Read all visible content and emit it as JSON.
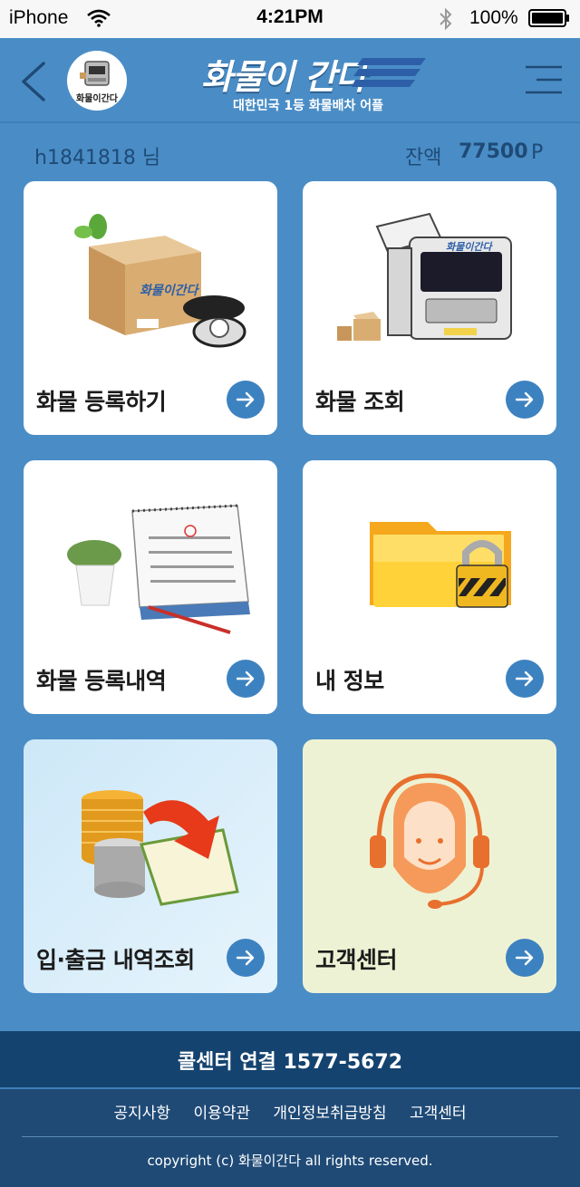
{
  "status_bar": {
    "carrier": "iPhone",
    "time": "4:21PM",
    "battery": "100%"
  },
  "header": {
    "logo_title": "화물이 간다",
    "logo_subtitle": "대한민국 1등 화물배차 어플",
    "avatar_text": "화물이간다"
  },
  "user": {
    "id": "h1841818 님",
    "balance_label": "잔액",
    "balance_value": "77500",
    "balance_unit": "P"
  },
  "menu": [
    {
      "label": "화물 등록하기",
      "icon": "cargo-box-phone-icon"
    },
    {
      "label": "화물 조회",
      "icon": "truck-icon"
    },
    {
      "label": "화물 등록내역",
      "icon": "calendar-icon"
    },
    {
      "label": "내 정보",
      "icon": "locked-folder-icon"
    },
    {
      "label": "입·출금 내역조회",
      "icon": "coins-icon"
    },
    {
      "label": "고객센터",
      "icon": "support-agent-icon"
    }
  ],
  "illustration_text": {
    "box_brand": "화물이간다",
    "truck_brand": "화물이간다"
  },
  "footer": {
    "call": "콜센터 연결 1577-5672",
    "links": [
      "공지사항",
      "이용약관",
      "개인정보취급방침",
      "고객센터"
    ],
    "copyright": "copyright (c) 화물이간다 all rights reserved."
  },
  "colors": {
    "background": "#4a8dc6",
    "footer": "#1f4a76",
    "accent": "#3d82c0"
  }
}
